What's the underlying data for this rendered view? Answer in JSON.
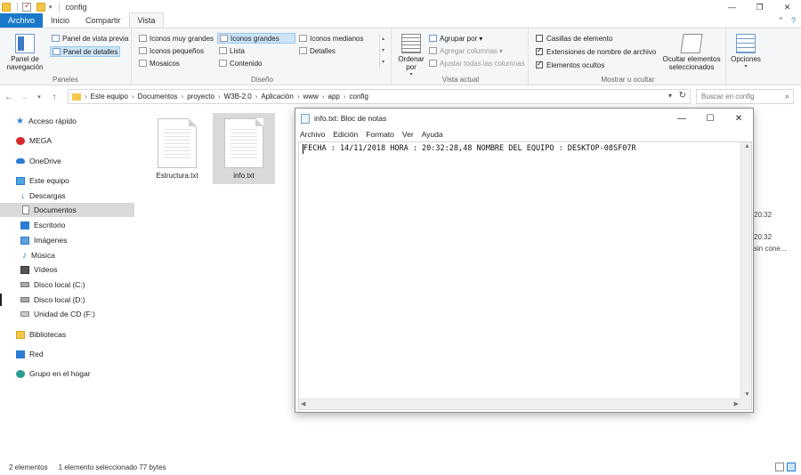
{
  "window": {
    "title": "config",
    "controls": {
      "minimize": "—",
      "maximize": "❐",
      "close": "✕"
    }
  },
  "ribbon_tabs": [
    "Archivo",
    "Inicio",
    "Compartir",
    "Vista"
  ],
  "ribbon": {
    "panes": {
      "nav_pane_label": "Panel de navegación",
      "preview_pane_label": "Panel de vista previa",
      "details_pane_label": "Panel de detalles",
      "group_label": "Paneles"
    },
    "layout": {
      "extra_large_icons": "Iconos muy grandes",
      "large_icons": "Iconos grandes",
      "medium_icons": "Iconos medianos",
      "small_icons": "Iconos pequeños",
      "list": "Lista",
      "details": "Detalles",
      "tiles": "Mosaicos",
      "content": "Contenido",
      "group_label": "Diseño"
    },
    "current_view": {
      "sort_by": "Ordenar por",
      "group_by": "Agrupar por",
      "add_columns": "Agregar columnas",
      "size_columns": "Ajustar todas las columnas",
      "group_label": "Vista actual"
    },
    "show_hide": {
      "item_checkboxes": "Casillas de elemento",
      "item_checkboxes_checked": false,
      "file_extensions": "Extensiones de nombre de archivo",
      "file_extensions_checked": true,
      "hidden_items": "Elementos ocultos",
      "hidden_items_checked": true,
      "hide_selected": "Ocultar elementos seleccionados",
      "group_label": "Mostrar u ocultar"
    },
    "options_label": "Opciones"
  },
  "address": {
    "breadcrumbs": [
      "Este equipo",
      "Documentos",
      "proyecto",
      "W3B-2.0",
      "Aplicación",
      "www",
      "app",
      "config"
    ],
    "search_placeholder": "Buscar en config"
  },
  "nav_pane": {
    "items": [
      {
        "label": "Acceso rápido",
        "icon": "star-icon"
      },
      {
        "label": "MEGA",
        "icon": "mega-icon"
      },
      {
        "label": "OneDrive",
        "icon": "cloud-icon"
      },
      {
        "label": "Este equipo",
        "icon": "computer-icon"
      },
      {
        "label": "Descargas",
        "icon": "download-icon"
      },
      {
        "label": "Documentos",
        "icon": "document-icon"
      },
      {
        "label": "Escritorio",
        "icon": "desktop-icon"
      },
      {
        "label": "Imágenes",
        "icon": "picture-icon"
      },
      {
        "label": "Música",
        "icon": "music-icon"
      },
      {
        "label": "Vídeos",
        "icon": "video-icon"
      },
      {
        "label": "Disco local (C:)",
        "icon": "disk-icon"
      },
      {
        "label": "Disco local (D:)",
        "icon": "disk-icon"
      },
      {
        "label": "Unidad de CD (F:)",
        "icon": "cd-icon"
      },
      {
        "label": "Bibliotecas",
        "icon": "library-icon"
      },
      {
        "label": "Red",
        "icon": "network-icon"
      },
      {
        "label": "Grupo en el hogar",
        "icon": "homegroup-icon"
      }
    ],
    "selected": "Documentos"
  },
  "files": [
    {
      "name": "Estructura.txt",
      "selected": false
    },
    {
      "name": "info.txt",
      "selected": true
    }
  ],
  "details_fragments": {
    "time1": "20:32",
    "time2": "20:32",
    "text": "sin cone..."
  },
  "status": {
    "count": "2 elementos",
    "selection": "1 elemento seleccionado  77 bytes"
  },
  "notepad": {
    "title": "info.txt: Bloc de notas",
    "menu": [
      "Archivo",
      "Edición",
      "Formato",
      "Ver",
      "Ayuda"
    ],
    "content": "FECHA : 14/11/2018 HORA : 20:32:28,48 NOMBRE DEL EQUIPO : DESKTOP-08SF07R"
  }
}
